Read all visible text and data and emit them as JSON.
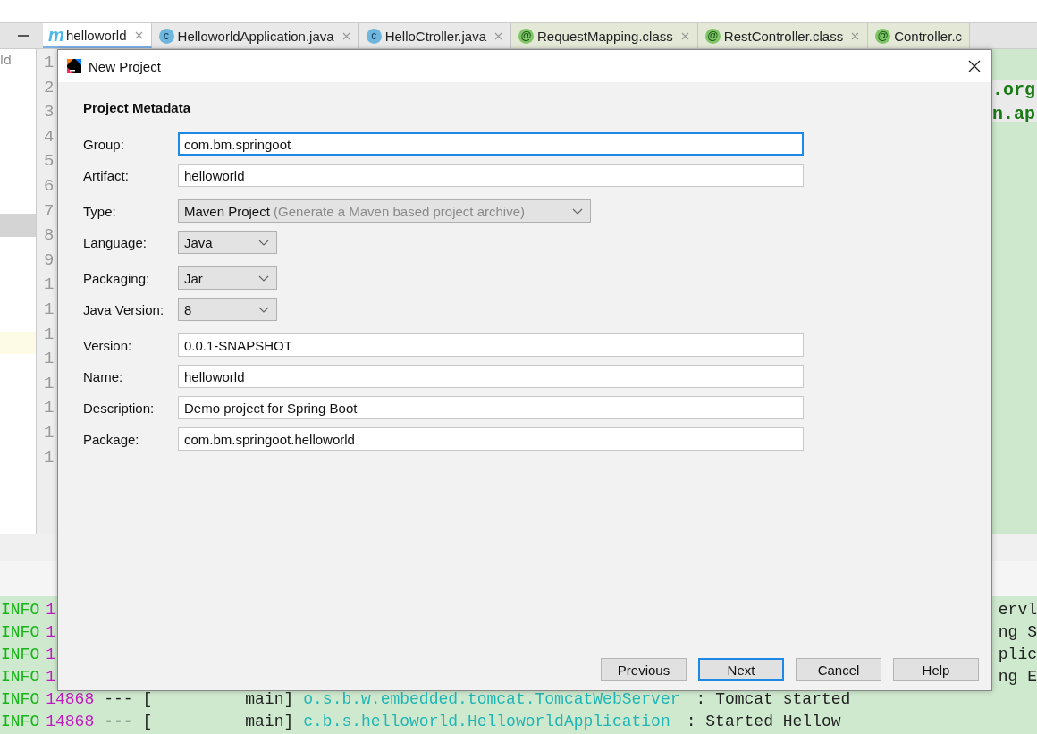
{
  "editor_tabs": [
    {
      "label": "helloworld",
      "icon": {
        "kind": "maven",
        "glyph": "m"
      },
      "selected": true,
      "closable": true
    },
    {
      "label": "HelloworldApplication.java",
      "icon": {
        "kind": "class",
        "glyph": "c"
      },
      "selected": false,
      "closable": true
    },
    {
      "label": "HelloCtroller.java",
      "icon": {
        "kind": "class",
        "glyph": "c"
      },
      "selected": false,
      "closable": true
    },
    {
      "label": "RequestMapping.class",
      "icon": {
        "kind": "annotation",
        "glyph": "@"
      },
      "selected": false,
      "closable": true
    },
    {
      "label": "RestController.class",
      "icon": {
        "kind": "annotation",
        "glyph": "@"
      },
      "selected": false,
      "closable": true
    },
    {
      "label": "Controller.c",
      "icon": {
        "kind": "annotation",
        "glyph": "@"
      },
      "selected": false,
      "closable": false
    }
  ],
  "project_tree": {
    "items": [
      {
        "label": "ld",
        "selected": false
      }
    ]
  },
  "gutter": {
    "line_numbers": [
      "1",
      "2",
      "3",
      "4",
      "5",
      "6",
      "7",
      "8",
      "9",
      "1",
      "1",
      "1",
      "1",
      "1",
      "1",
      "1",
      "1"
    ]
  },
  "code_lines": [
    ".org",
    "n.ap"
  ],
  "console": {
    "lines": [
      {
        "level": "INFO",
        "pid": "1",
        "tail": "ervl"
      },
      {
        "level": "INFO",
        "pid": "1",
        "tail": "ng S"
      },
      {
        "level": "INFO",
        "pid": "1",
        "tail": "plic"
      },
      {
        "level": "INFO",
        "pid": "1",
        "tail": "ng E"
      },
      {
        "level": "INFO",
        "pid": "14868",
        "sep": "--- [",
        "thread": "main]",
        "logger": "o.s.b.w.embedded.tomcat.TomcatWebServer",
        "message": ": Tomcat started"
      },
      {
        "level": "INFO",
        "pid": "14868",
        "sep": "--- [",
        "thread": "main]",
        "logger": "c.b.s.helloworld.HelloworldApplication",
        "message": ": Started Hellow"
      }
    ]
  },
  "dialog": {
    "title": "New Project",
    "section": "Project Metadata",
    "field_groups": [
      [
        {
          "kind": "text",
          "label": "Group:",
          "value": "com.bm.springoot",
          "focused": true
        },
        {
          "kind": "text",
          "label": "Artifact:",
          "value": "helloworld",
          "focused": false
        }
      ],
      [
        {
          "kind": "select",
          "label": "Type:",
          "value": "Maven Project",
          "hint": "(Generate a Maven based project archive)",
          "wide": true
        },
        {
          "kind": "select",
          "label": "Language:",
          "value": "Java",
          "wide": false
        }
      ],
      [
        {
          "kind": "select",
          "label": "Packaging:",
          "value": "Jar",
          "wide": false
        },
        {
          "kind": "select",
          "label": "Java Version:",
          "value": "8",
          "wide": false
        }
      ],
      [
        {
          "kind": "text",
          "label": "Version:",
          "value": "0.0.1-SNAPSHOT",
          "focused": false
        },
        {
          "kind": "text",
          "label": "Name:",
          "value": "helloworld",
          "focused": false
        },
        {
          "kind": "text",
          "label": "Description:",
          "value": "Demo project for Spring Boot",
          "focused": false
        },
        {
          "kind": "text",
          "label": "Package:",
          "value": "com.bm.springoot.helloworld",
          "focused": false
        }
      ]
    ],
    "buttons": [
      {
        "label": "Previous",
        "default": false
      },
      {
        "label": "Next",
        "default": true
      },
      {
        "label": "Cancel",
        "default": false
      },
      {
        "label": "Help",
        "default": false
      }
    ]
  }
}
